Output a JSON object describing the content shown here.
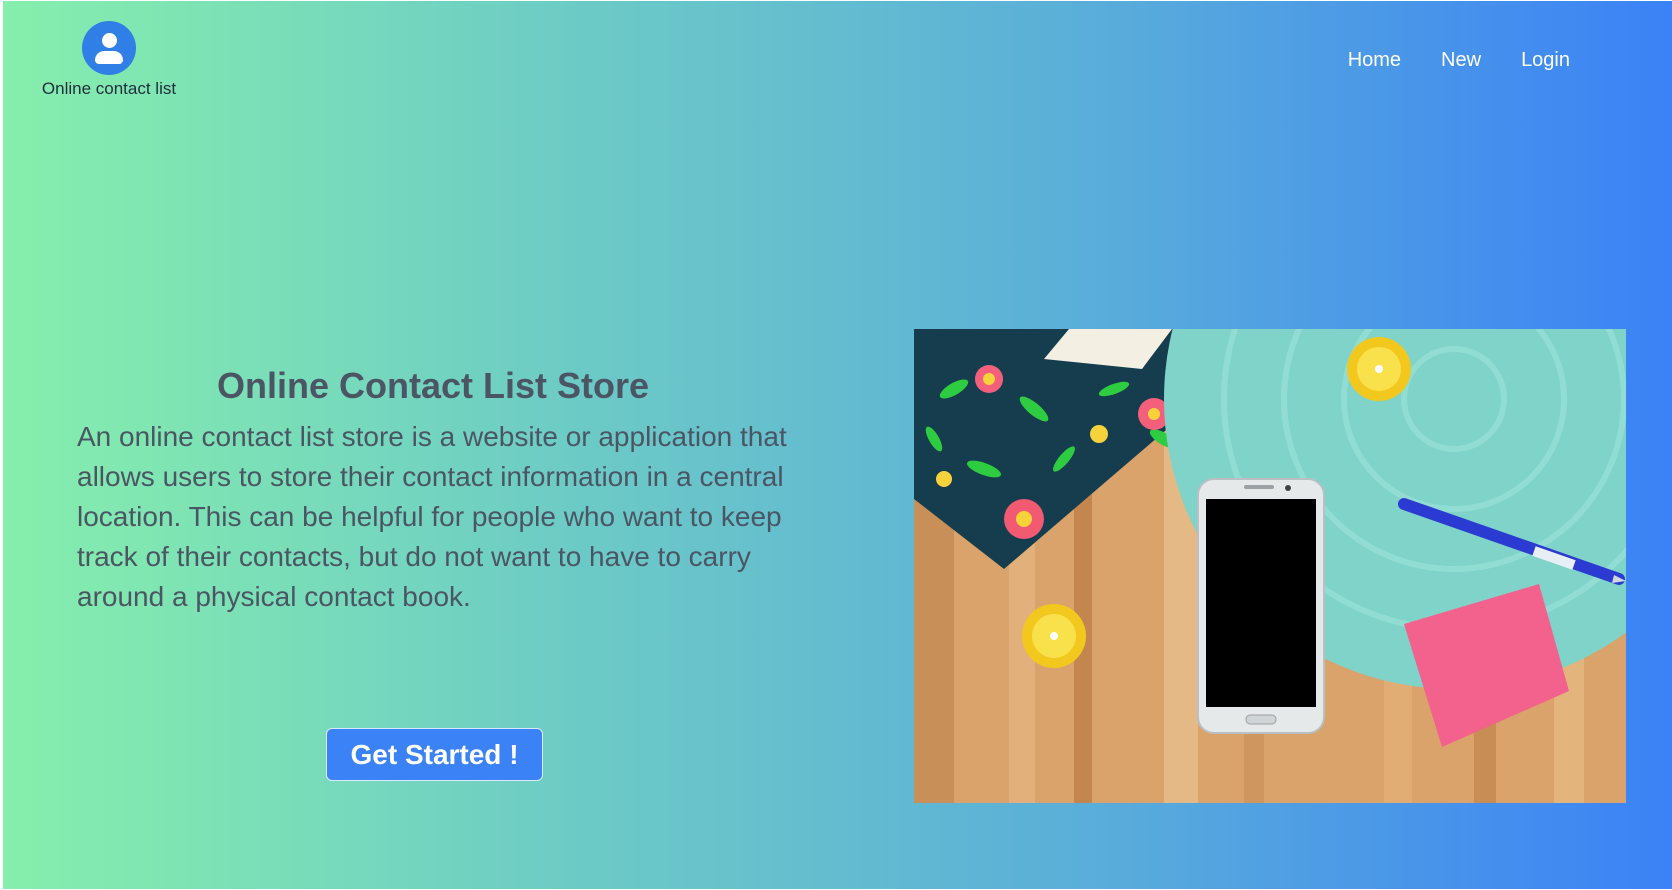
{
  "header": {
    "brand_name": "Online contact list",
    "logo_icon": "contact-person-icon",
    "nav": [
      {
        "label": "Home"
      },
      {
        "label": "New"
      },
      {
        "label": "Login"
      }
    ]
  },
  "hero": {
    "title": "Online Contact List Store",
    "description": "An online contact list store is a website or application that allows users to store their contact information in a central location. This can be helpful for people who want to keep track of their contacts, but do not want to have to carry around a physical contact book.",
    "cta_label": "Get Started !"
  },
  "colors": {
    "gradient_start": "#86efac",
    "gradient_end": "#3b82f6",
    "button": "#3b82f6",
    "text": "#4b5563"
  }
}
